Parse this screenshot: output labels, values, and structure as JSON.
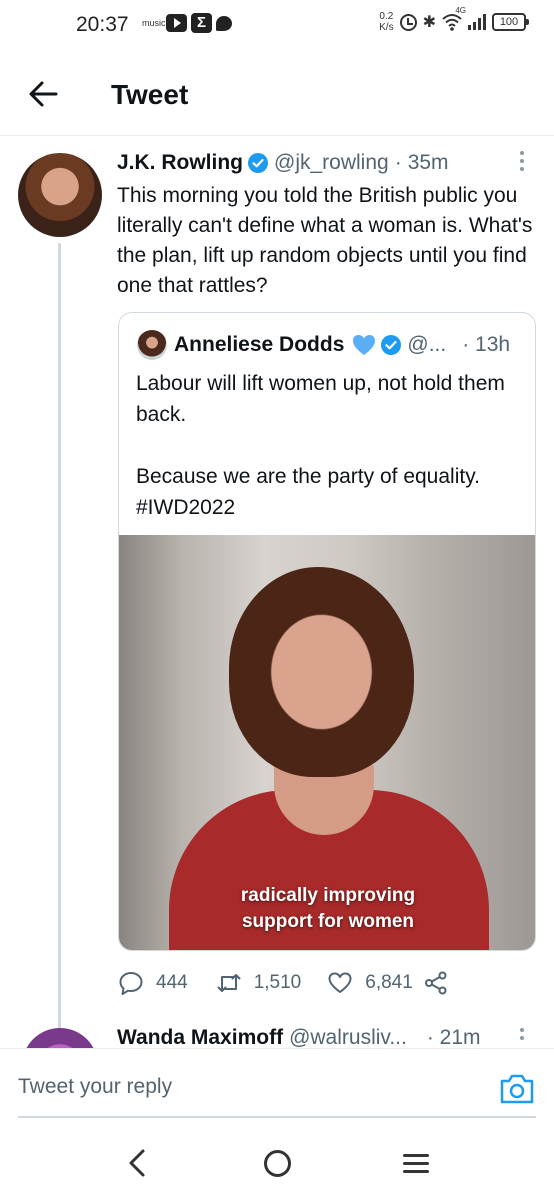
{
  "status_bar": {
    "time": "20:37",
    "music_label": "music",
    "net_speed_value": "0.2",
    "net_speed_unit": "K/s",
    "network_type": "4G",
    "battery": "100",
    "icons": [
      "youtube-music-icon",
      "youtube-icon",
      "sigma-icon",
      "chat-icon",
      "alarm-icon",
      "bluetooth-icon",
      "wifi-icon",
      "signal-icon",
      "battery-icon"
    ]
  },
  "header": {
    "back_icon": "arrow-left-icon",
    "title": "Tweet"
  },
  "tweet": {
    "author_name": "J.K. Rowling",
    "handle": "@jk_rowling",
    "separator": "·",
    "time": "35m",
    "text": "This morning you told the British public you literally can't define what a woman is. What's the plan, lift up random objects until you find one that rattles?",
    "quote": {
      "author_name": "Anneliese Dodds",
      "handle": "@...",
      "time": "· 13h",
      "text": "Labour will lift women up, not hold them back.\n\nBecause we are the party of equality. #IWD2022",
      "media_caption_line1": "radically improving",
      "media_caption_line2": "support for women"
    },
    "actions": {
      "replies": "444",
      "retweets": "1,510",
      "likes": "6,841"
    }
  },
  "next_tweet": {
    "author_name": "Wanda Maximoff",
    "handle": "@walrusliv...",
    "time": "· 21m"
  },
  "reply_bar": {
    "placeholder": "Tweet your reply"
  },
  "colors": {
    "verified_blue": "#1d9bf0",
    "heart_blue": "#5aaef5",
    "muted_text": "#536471"
  }
}
